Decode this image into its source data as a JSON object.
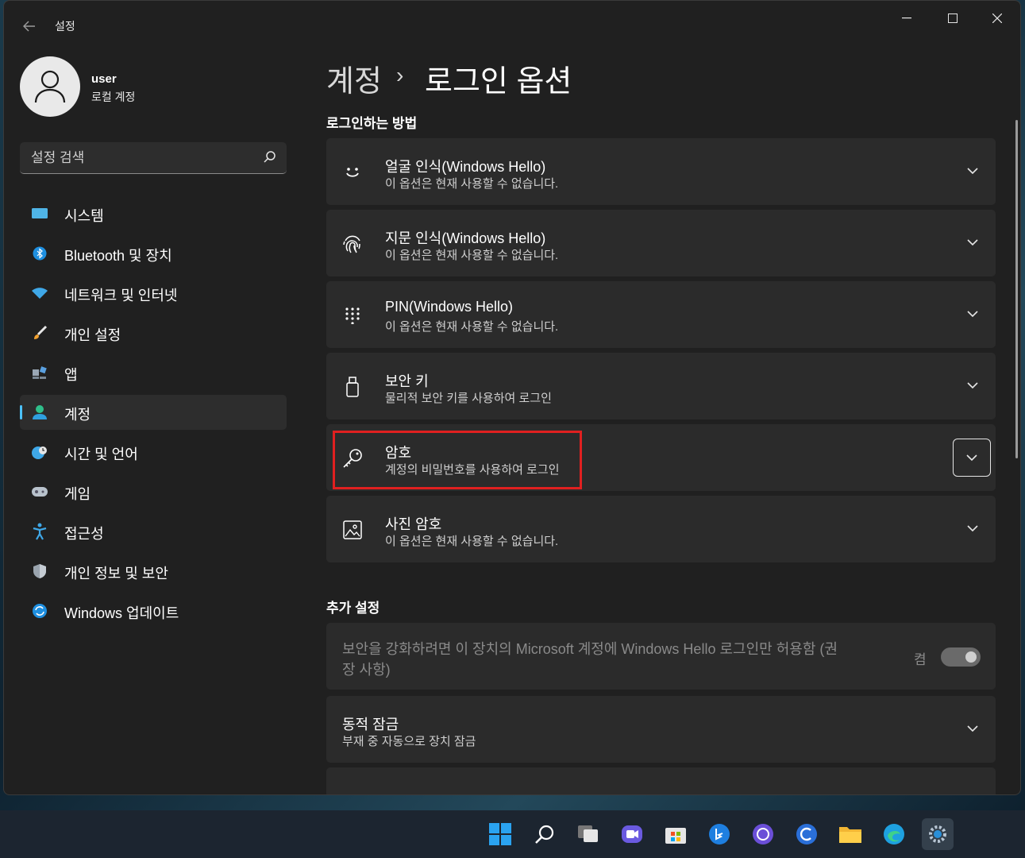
{
  "window": {
    "title": "설정",
    "back_icon": "back-arrow-icon",
    "controls": {
      "minimize": "—",
      "maximize": "☐",
      "close": "✕"
    }
  },
  "user": {
    "name": "user",
    "type": "로컬 계정"
  },
  "search": {
    "placeholder": "설정 검색"
  },
  "sidebar": {
    "items": [
      {
        "label": "시스템",
        "icon": "system-icon"
      },
      {
        "label": "Bluetooth 및 장치",
        "icon": "bluetooth-icon"
      },
      {
        "label": "네트워크 및 인터넷",
        "icon": "wifi-icon"
      },
      {
        "label": "개인 설정",
        "icon": "brush-icon"
      },
      {
        "label": "앱",
        "icon": "apps-icon"
      },
      {
        "label": "계정",
        "icon": "account-icon",
        "active": true
      },
      {
        "label": "시간 및 언어",
        "icon": "globe-clock-icon"
      },
      {
        "label": "게임",
        "icon": "gamepad-icon"
      },
      {
        "label": "접근성",
        "icon": "accessibility-icon"
      },
      {
        "label": "개인 정보 및 보안",
        "icon": "shield-icon"
      },
      {
        "label": "Windows 업데이트",
        "icon": "update-icon"
      }
    ]
  },
  "breadcrumb": {
    "parent": "계정",
    "separator": "›",
    "current": "로그인 옵션"
  },
  "section_signin": {
    "title": "로그인하는 방법"
  },
  "signin_options": [
    {
      "title": "얼굴 인식(Windows Hello)",
      "subtitle": "이 옵션은 현재 사용할 수 없습니다.",
      "icon": "face-icon"
    },
    {
      "title": "지문 인식(Windows Hello)",
      "subtitle": "이 옵션은 현재 사용할 수 없습니다.",
      "icon": "fingerprint-icon"
    },
    {
      "title": "PIN(Windows Hello)",
      "subtitle": "이 옵션은 현재 사용할 수 없습니다.",
      "icon": "pin-keypad-icon"
    },
    {
      "title": "보안 키",
      "subtitle": "물리적 보안 키를 사용하여 로그인",
      "icon": "usb-key-icon"
    },
    {
      "title": "암호",
      "subtitle": "계정의 비밀번호를 사용하여 로그인",
      "icon": "key-icon",
      "highlighted": true
    },
    {
      "title": "사진 암호",
      "subtitle": "이 옵션은 현재 사용할 수 없습니다.",
      "icon": "picture-icon"
    }
  ],
  "section_additional": {
    "title": "추가 설정"
  },
  "additional": {
    "hello_only": {
      "text": "보안을 강화하려면 이 장치의 Microsoft 계정에 Windows Hello 로그인만 허용함 (권장 사항)",
      "state": "켬",
      "enabled": true
    },
    "dynamic_lock": {
      "title": "동적 잠금",
      "subtitle": "부재 중 자동으로 장치 잠금"
    }
  },
  "taskbar": {
    "icons": [
      "start-icon",
      "search-icon",
      "task-view-icon",
      "chat-icon",
      "store-icon",
      "bing-icon",
      "app-icon",
      "app-icon-2",
      "file-explorer-icon",
      "edge-icon",
      "settings-icon"
    ]
  },
  "colors": {
    "accent": "#4cc2ff",
    "highlight_border": "#e02020",
    "window_bg": "#202020",
    "card_bg": "#2b2b2b"
  }
}
